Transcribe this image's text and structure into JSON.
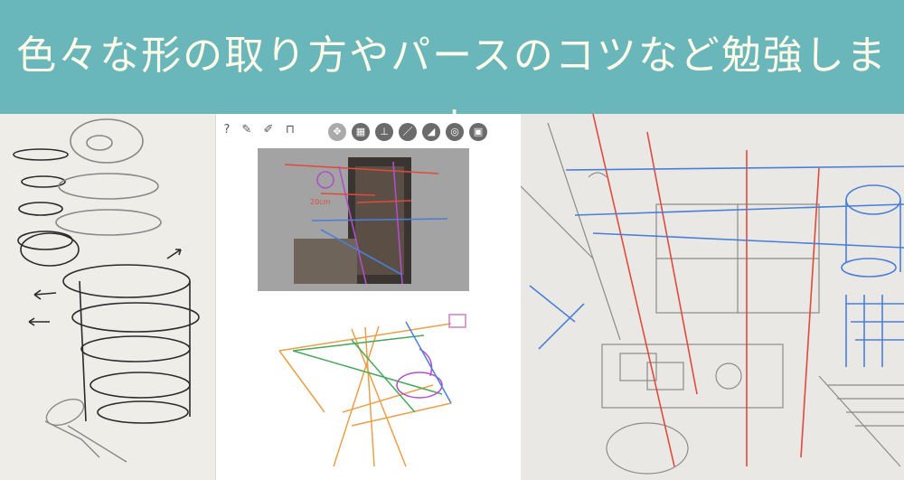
{
  "banner": {
    "title": "色々な形の取り方やパースのコツなど勉強します",
    "background_color": "#69b6bb",
    "text_color": "#fffbe8"
  },
  "left_panel": {
    "subject": "cylinder-shapes-sketch"
  },
  "middle_panel": {
    "toolbar": {
      "help_label": "?",
      "icons": [
        "help-icon",
        "wrench-icon",
        "brush-icon",
        "frame-icon",
        "move-icon",
        "grid-icon",
        "perspective-icon",
        "line-icon",
        "ruler-icon",
        "circle-tool-icon",
        "layers-icon"
      ]
    },
    "annotations": {
      "label_20cm": "20cm"
    }
  },
  "right_panel": {
    "subject": "room-perspective-sketch"
  },
  "colors": {
    "perspective_red": "#e04b3c",
    "perspective_blue": "#4a7fd9",
    "guide_orange": "#e9a04a",
    "guide_green": "#4aa85a",
    "guide_purple": "#b050c8",
    "pencil_gray": "#7a7a7a"
  }
}
